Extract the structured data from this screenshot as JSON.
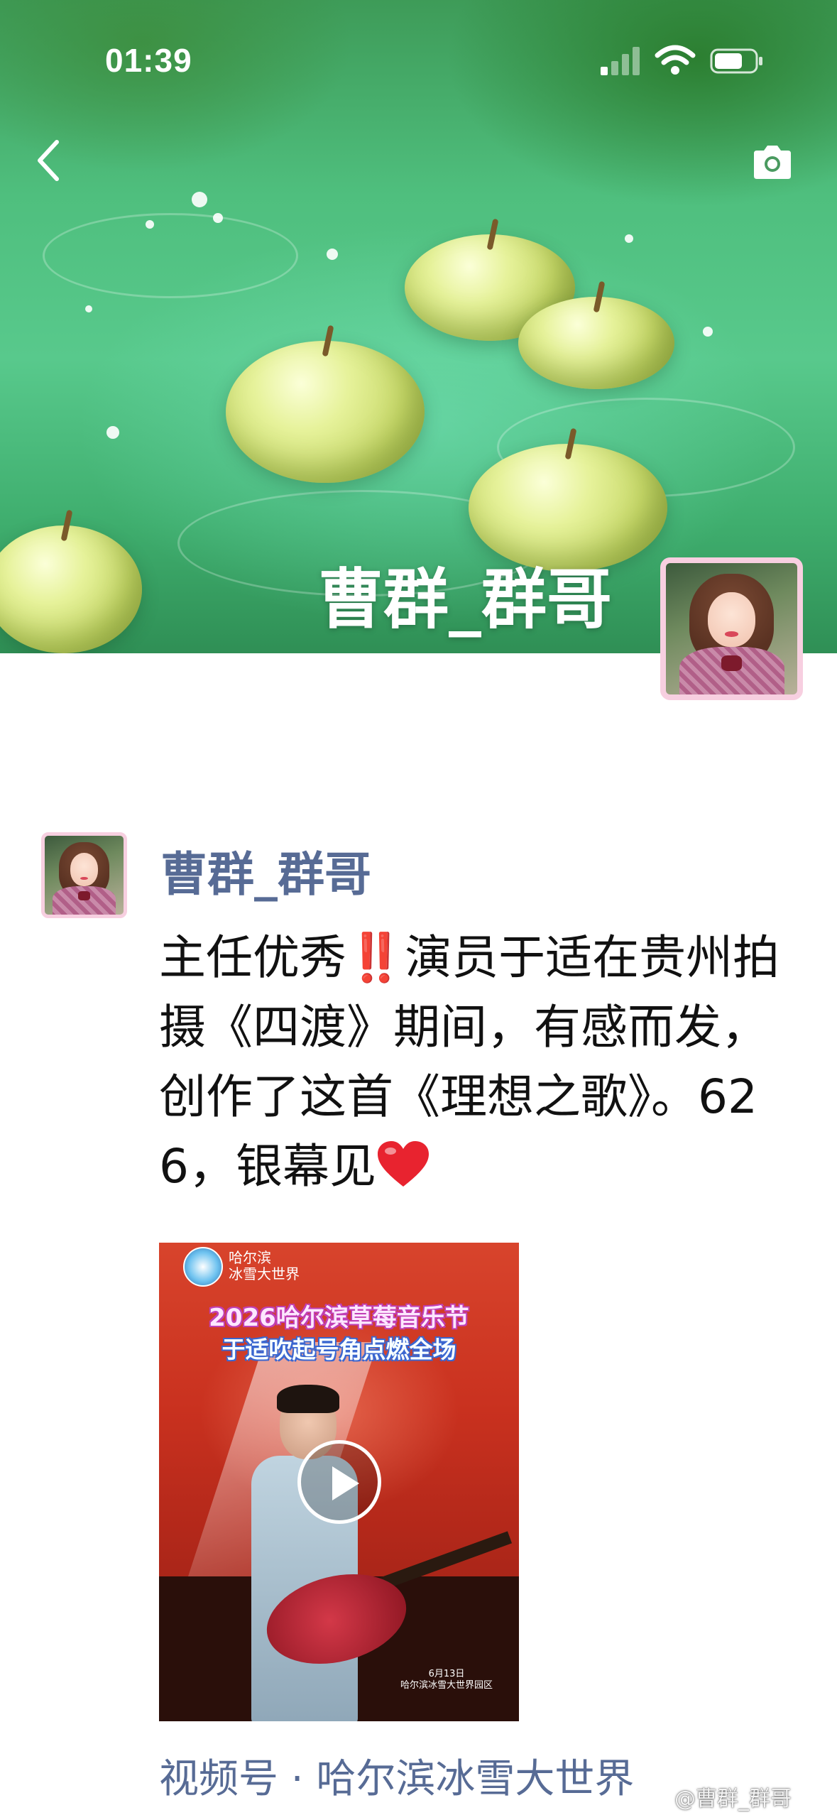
{
  "status_bar": {
    "time": "01:39",
    "signal_icon": "signal-icon",
    "wifi_icon": "wifi-icon",
    "battery_icon": "battery-icon"
  },
  "header": {
    "back_icon": "chevron-left-icon",
    "camera_icon": "camera-icon"
  },
  "cover": {
    "name": "曹群_群哥"
  },
  "post": {
    "username": "曹群_群哥",
    "text_before_emoji": "主任优秀",
    "exclaim_emoji": "‼️",
    "text_after_emoji": "演员于适在贵州拍摄《四渡》期间，有感而发，创作了这首《理想之歌》。626，银幕见",
    "heart_emoji": "❤️",
    "video": {
      "logo_text_line1": "哈尔滨",
      "logo_text_line2": "冰雪大世界",
      "headline_line1": "2026哈尔滨草莓音乐节",
      "headline_line2": "于适吹起号角点燃全场",
      "date_line1": "6月13日",
      "date_line2": "哈尔滨冰雪大世界园区",
      "play_icon": "play-icon"
    },
    "source_label": "视频号 · 哈尔滨冰雪大世界"
  },
  "watermark": "@曹群_群哥",
  "colors": {
    "link_blue": "#576b95",
    "avatar_border": "#f7cfe0",
    "text": "#111111"
  }
}
